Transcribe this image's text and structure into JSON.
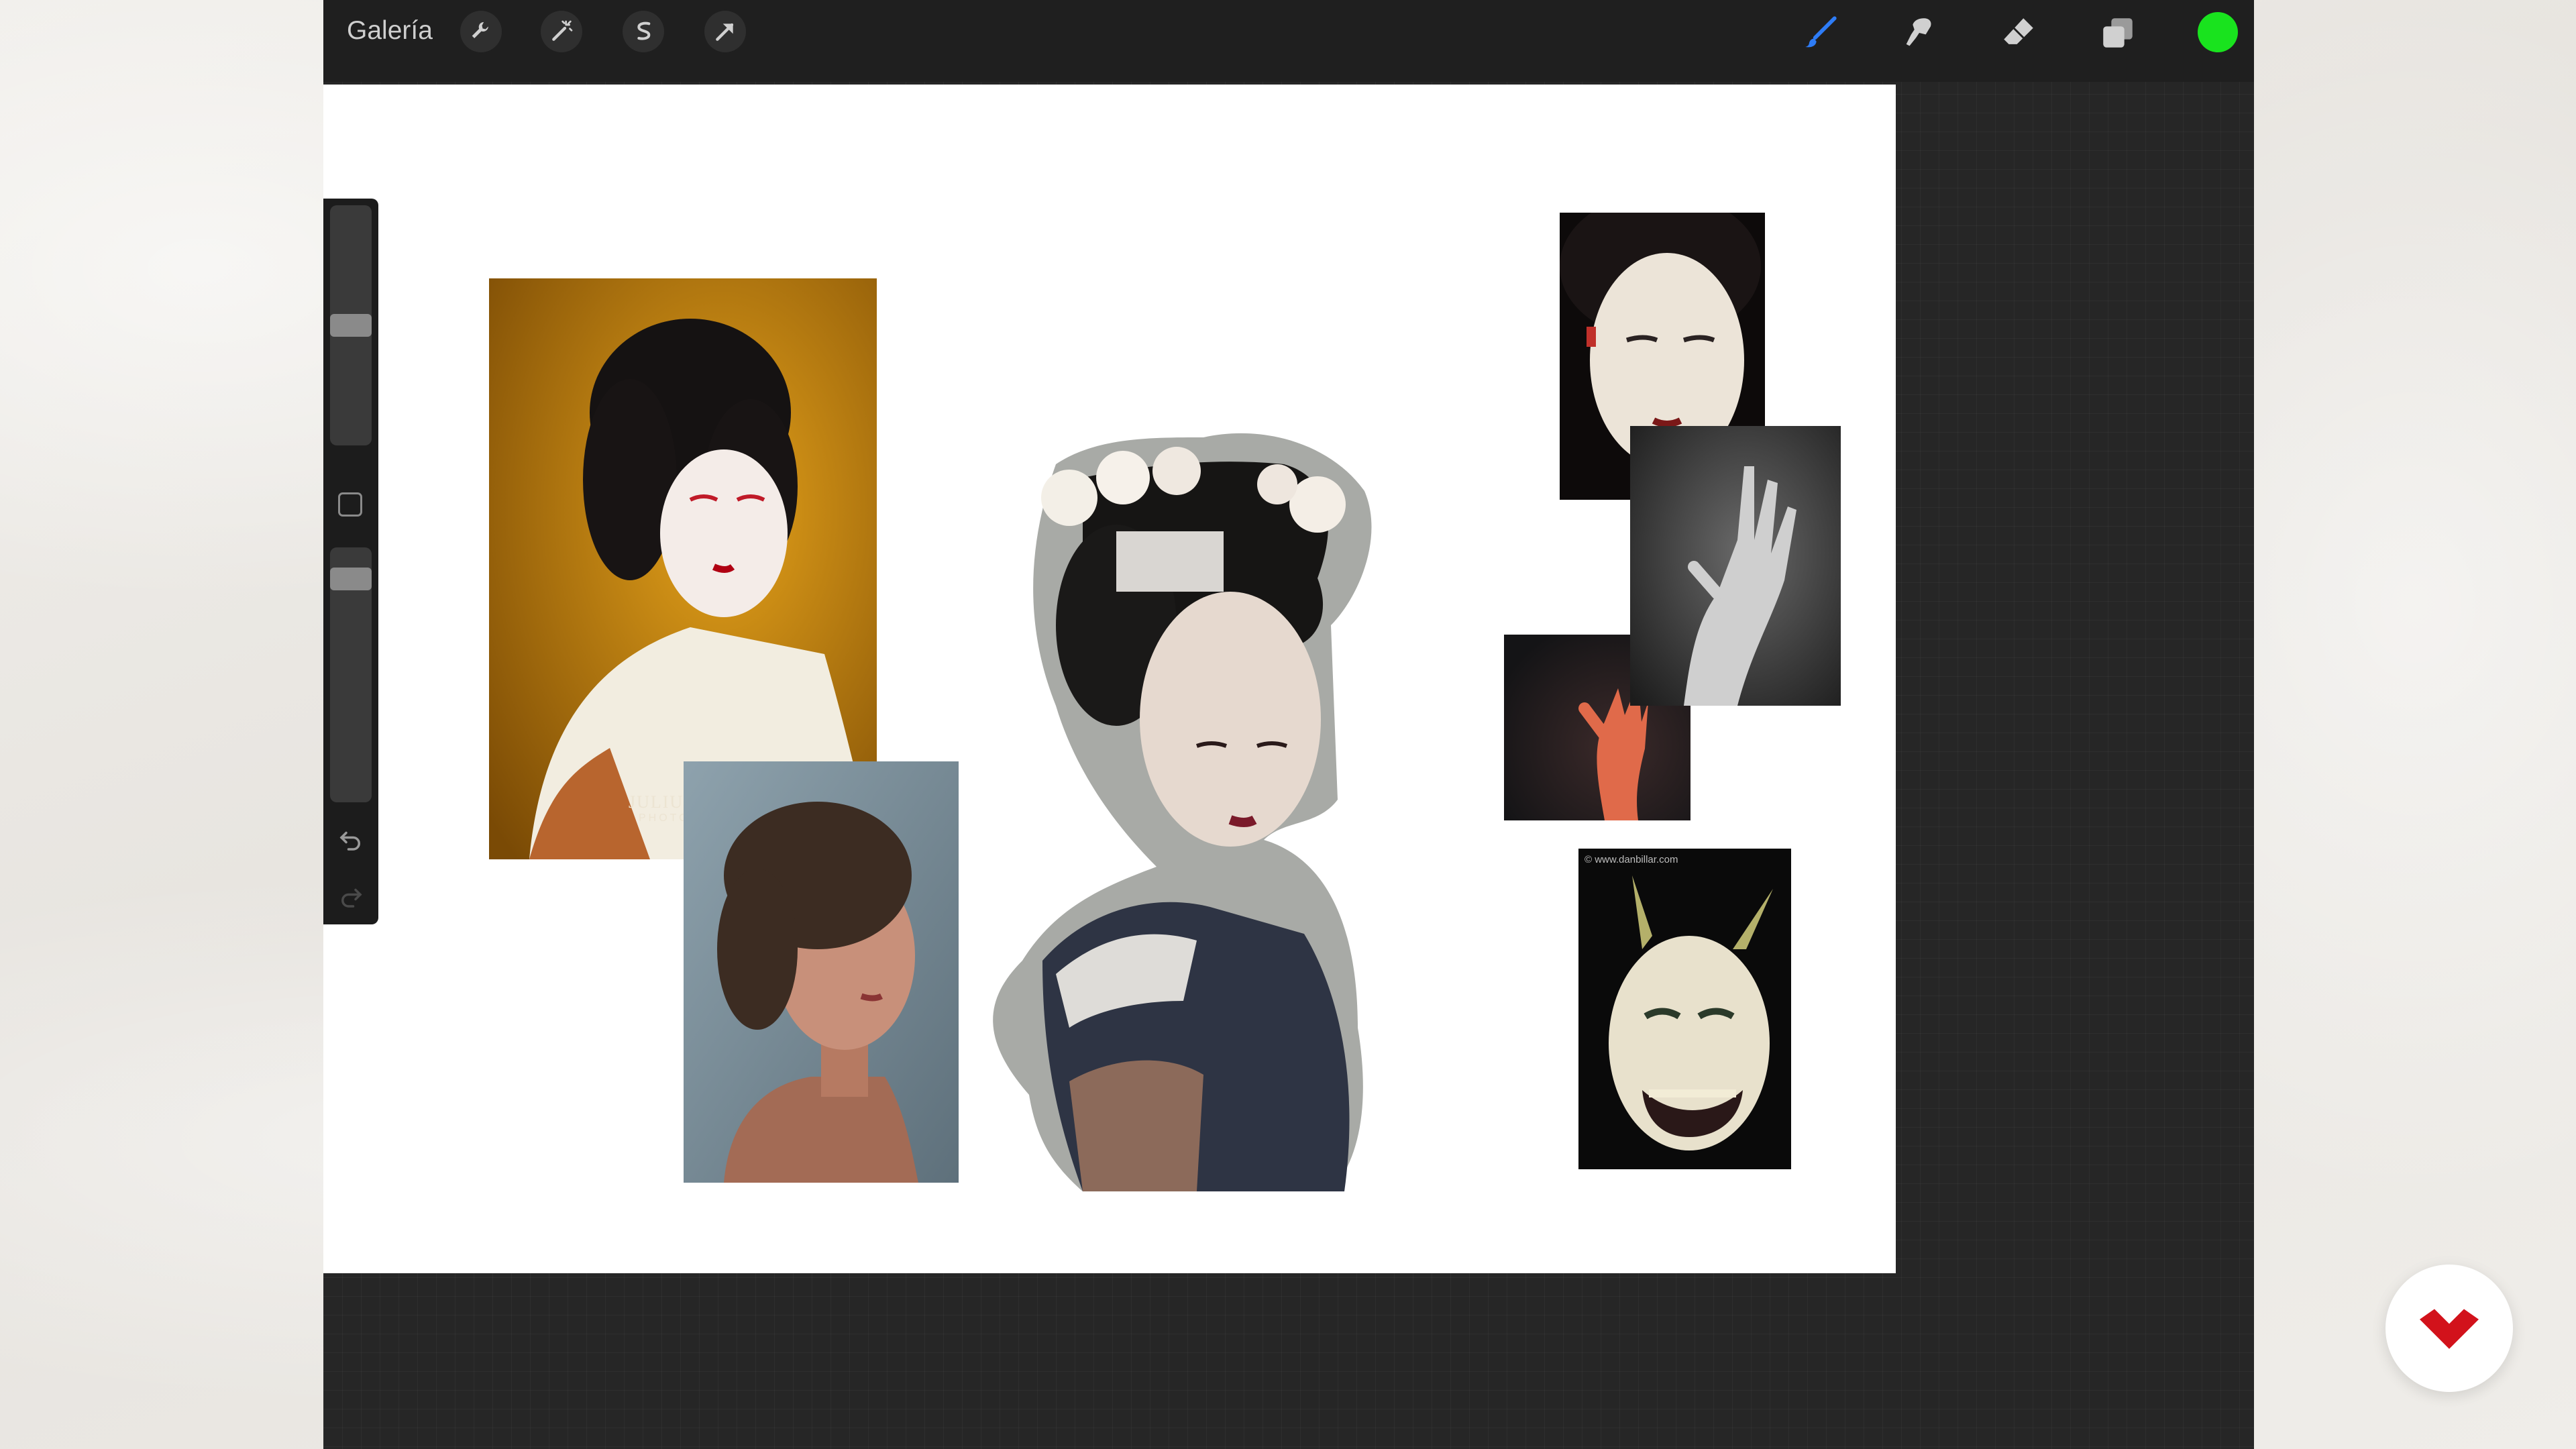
{
  "toolbar": {
    "gallery_label": "Galería",
    "left_tools": [
      {
        "name": "actions",
        "icon": "wrench-icon"
      },
      {
        "name": "adjustments",
        "icon": "magic-wand-icon"
      },
      {
        "name": "selection",
        "icon": "selection-s-icon"
      },
      {
        "name": "transform",
        "icon": "transform-arrow-icon"
      }
    ],
    "right_tools": [
      {
        "name": "brush",
        "icon": "brush-icon",
        "active": true
      },
      {
        "name": "smudge",
        "icon": "smudge-icon"
      },
      {
        "name": "eraser",
        "icon": "eraser-icon"
      },
      {
        "name": "layers",
        "icon": "layers-icon"
      }
    ],
    "current_color": "#19e31e",
    "active_tool_color": "#2e7cf6"
  },
  "sidebar": {
    "brush_size_level": 0.5,
    "opacity_level": 0.95,
    "icons": [
      "modifier-square-icon",
      "undo-icon",
      "redo-icon"
    ]
  },
  "canvas": {
    "background": "#ffffff",
    "references": [
      {
        "name": "geisha-yellow-photo",
        "watermark": "JULIUS",
        "watermark_sub": "PHOTO"
      },
      {
        "name": "woman-portrait-photo"
      },
      {
        "name": "geisha-illustration-cutout"
      },
      {
        "name": "noh-mask-photo"
      },
      {
        "name": "hand-bw-photo"
      },
      {
        "name": "hand-red-photo"
      },
      {
        "name": "hannya-mask-photo",
        "watermark": "© www.danbillar.com"
      }
    ]
  },
  "brand": {
    "icon": "domestika-logo-icon",
    "color": "#d2121b"
  }
}
